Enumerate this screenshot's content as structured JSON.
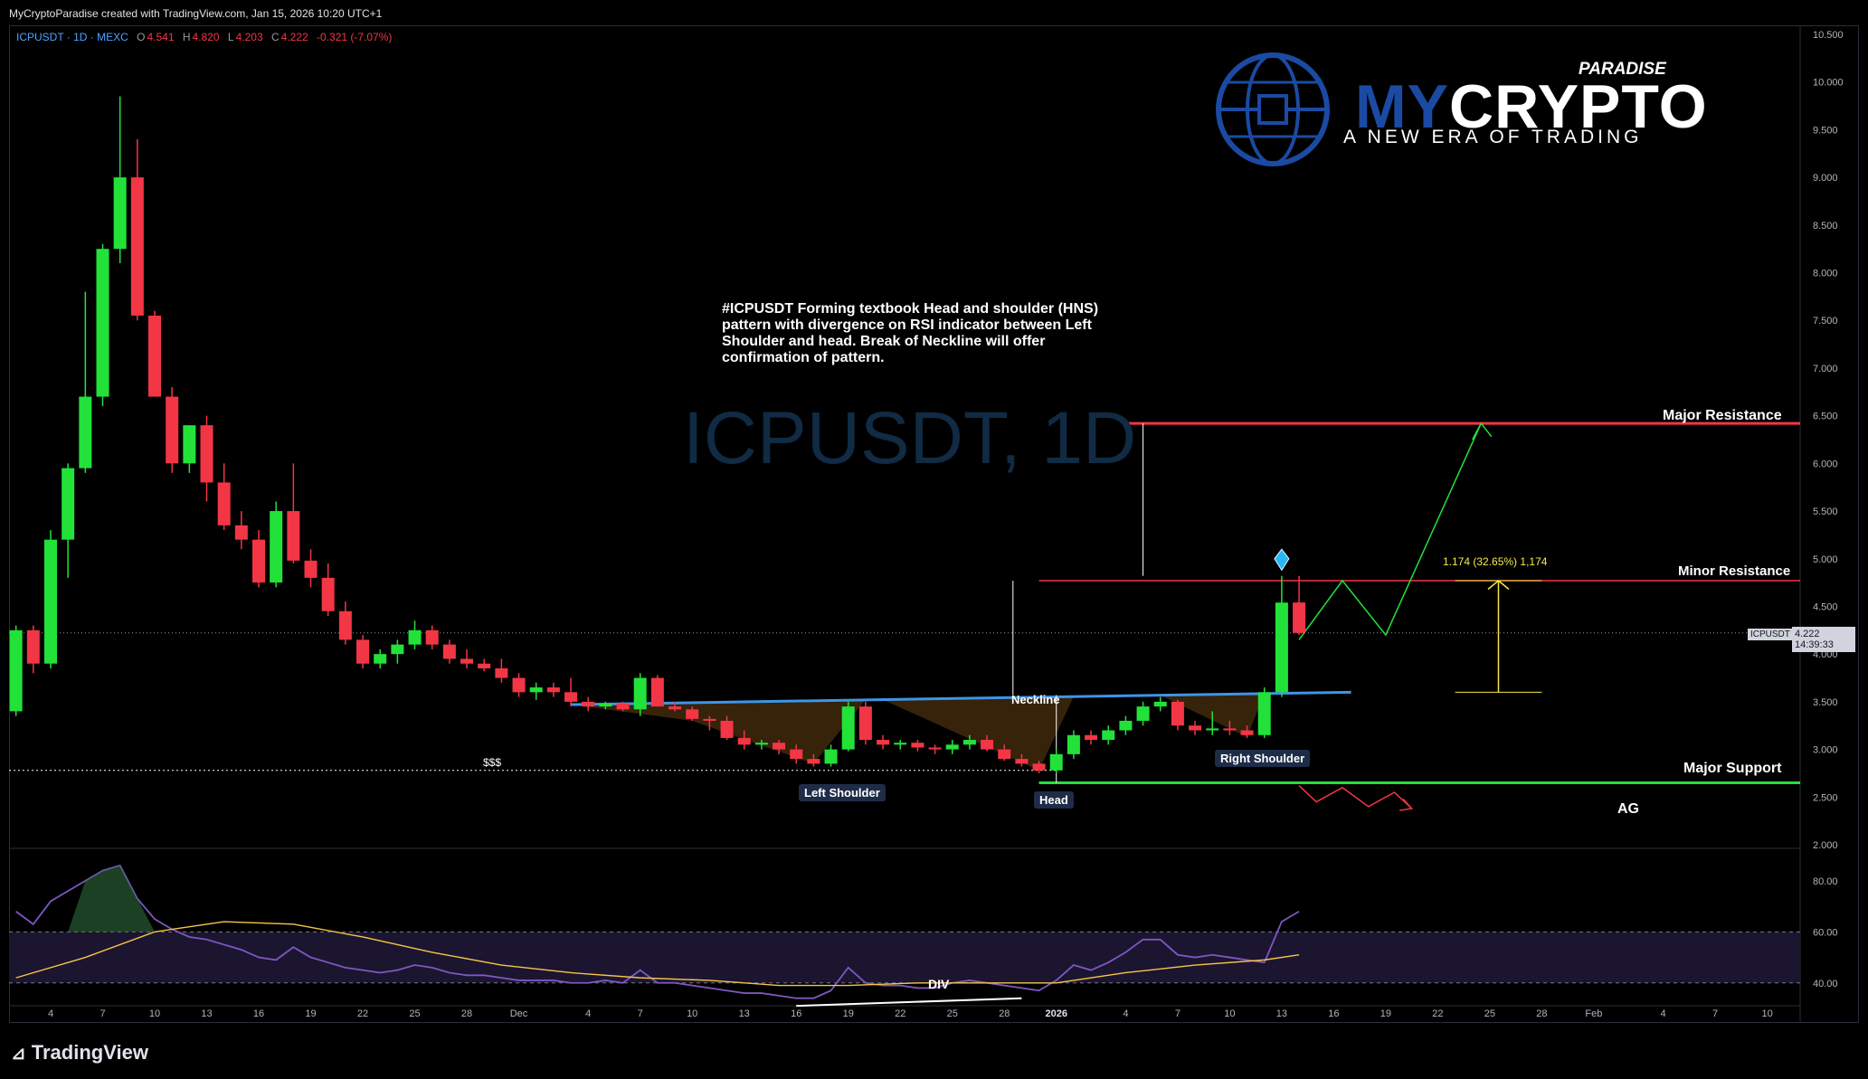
{
  "header": {
    "credit": "MyCryptoParadise created with TradingView.com, Jan 15, 2026 10:20 UTC+1",
    "symbol": "ICPUSDT · 1D · MEXC",
    "ohlc": {
      "o_label": "O",
      "o": "4.541",
      "h_label": "H",
      "h": "4.820",
      "l_label": "L",
      "l": "4.203",
      "c_label": "C",
      "c": "4.222",
      "change": "-0.321 (-7.07%)"
    }
  },
  "brand": {
    "name_part1": "MY",
    "name_part2": "CRYPTO",
    "paradise": "PARADISE",
    "tagline": "A NEW ERA OF TRADING",
    "colors": {
      "blue": "#1b4aa3",
      "white": "#ffffff"
    }
  },
  "analysis_text": "#ICPUSDT Forming textbook Head and shoulder (HNS) pattern with divergence on RSI indicator between Left Shoulder and head. Break of Neckline will offer confirmation of pattern.",
  "watermark": "ICPUSDT, 1D",
  "levels": {
    "major_resistance": {
      "label": "Major Resistance",
      "value": 6.42,
      "color": "#f23645"
    },
    "minor_resistance": {
      "label": "Minor Resistance",
      "value": 4.77,
      "color": "#f23645"
    },
    "major_support": {
      "label": "Major Support",
      "value": 2.65,
      "color": "#22e23a"
    },
    "dotted_level": {
      "label": "$$$",
      "value": 2.78
    }
  },
  "pattern_labels": {
    "neckline": "Neckline",
    "left_shoulder": "Left Shoulder",
    "head": "Head",
    "right_shoulder": "Right Shoulder",
    "div": "DIV",
    "ag": "AG"
  },
  "fib_text": "1.174 (32.65%) 1,174",
  "last_price": {
    "symbol": "ICPUSDT",
    "price": "4.222",
    "countdown": "14:39:33",
    "value": 4.222
  },
  "footer": {
    "logo": "TradingView"
  },
  "chart_data": [
    {
      "type": "candlestick",
      "title": "",
      "x_tick_labels": [
        "4",
        "7",
        "10",
        "13",
        "16",
        "19",
        "22",
        "25",
        "28",
        "Dec",
        "4",
        "7",
        "10",
        "13",
        "16",
        "19",
        "22",
        "25",
        "28",
        "2026",
        "4",
        "7",
        "10",
        "13",
        "16",
        "19",
        "22",
        "25",
        "28",
        "Feb",
        "4",
        "7",
        "10"
      ],
      "x_tick_days": [
        0,
        3,
        6,
        9,
        12,
        15,
        18,
        21,
        24,
        27,
        31,
        34,
        37,
        40,
        43,
        46,
        49,
        52,
        55,
        58,
        62,
        65,
        68,
        71,
        74,
        77,
        80,
        83,
        86,
        89,
        93,
        96,
        99
      ],
      "y_tick_labels": [
        "10.500",
        "10.000",
        "9.500",
        "9.000",
        "8.500",
        "8.000",
        "7.500",
        "7.000",
        "6.500",
        "6.000",
        "5.500",
        "5.000",
        "4.500",
        "4.000",
        "3.500",
        "3.000",
        "2.500",
        "2.000"
      ],
      "y_ticks": [
        10.5,
        10,
        9.5,
        9,
        8.5,
        8,
        7.5,
        7,
        6.5,
        6,
        5.5,
        5,
        4.5,
        4,
        3.5,
        3,
        2.5,
        2
      ],
      "ylim": [
        2.0,
        10.5
      ],
      "xlim": [
        -2.4,
        100.9
      ],
      "colors": {
        "up": "#22e23a",
        "down": "#f23645"
      },
      "candles": [
        [
          -2,
          3.4,
          4.3,
          3.35,
          4.25
        ],
        [
          -1,
          4.25,
          4.3,
          3.8,
          3.9
        ],
        [
          0,
          3.9,
          5.3,
          3.85,
          5.2
        ],
        [
          1,
          5.2,
          6.0,
          4.8,
          5.95
        ],
        [
          2,
          5.95,
          7.8,
          5.9,
          6.7
        ],
        [
          3,
          6.7,
          8.3,
          6.6,
          8.25
        ],
        [
          4,
          8.25,
          9.85,
          8.1,
          9.0
        ],
        [
          5,
          9.0,
          9.4,
          7.5,
          7.55
        ],
        [
          6,
          7.55,
          7.6,
          6.7,
          6.7
        ],
        [
          7,
          6.7,
          6.8,
          5.9,
          6.0
        ],
        [
          8,
          6.0,
          6.4,
          5.9,
          6.4
        ],
        [
          9,
          6.4,
          6.5,
          5.6,
          5.8
        ],
        [
          10,
          5.8,
          6.0,
          5.3,
          5.35
        ],
        [
          11,
          5.35,
          5.5,
          5.1,
          5.2
        ],
        [
          12,
          5.2,
          5.3,
          4.7,
          4.75
        ],
        [
          13,
          4.75,
          5.6,
          4.7,
          5.5
        ],
        [
          14,
          5.5,
          6.0,
          4.95,
          4.98
        ],
        [
          15,
          4.98,
          5.1,
          4.7,
          4.8
        ],
        [
          16,
          4.8,
          4.95,
          4.4,
          4.45
        ],
        [
          17,
          4.45,
          4.55,
          4.1,
          4.15
        ],
        [
          18,
          4.15,
          4.2,
          3.85,
          3.9
        ],
        [
          19,
          3.9,
          4.05,
          3.85,
          4.0
        ],
        [
          20,
          4.0,
          4.15,
          3.9,
          4.1
        ],
        [
          21,
          4.1,
          4.35,
          4.05,
          4.25
        ],
        [
          22,
          4.25,
          4.3,
          4.05,
          4.1
        ],
        [
          23,
          4.1,
          4.15,
          3.9,
          3.95
        ],
        [
          24,
          3.95,
          4.05,
          3.85,
          3.9
        ],
        [
          25,
          3.9,
          3.95,
          3.82,
          3.85
        ],
        [
          26,
          3.85,
          3.95,
          3.7,
          3.75
        ],
        [
          27,
          3.75,
          3.8,
          3.55,
          3.6
        ],
        [
          28,
          3.6,
          3.7,
          3.52,
          3.65
        ],
        [
          29,
          3.65,
          3.7,
          3.55,
          3.6
        ],
        [
          30,
          3.6,
          3.75,
          3.45,
          3.5
        ],
        [
          31,
          3.5,
          3.55,
          3.4,
          3.45
        ],
        [
          32,
          3.45,
          3.5,
          3.42,
          3.48
        ],
        [
          33,
          3.48,
          3.5,
          3.4,
          3.42
        ],
        [
          34,
          3.42,
          3.8,
          3.35,
          3.75
        ],
        [
          35,
          3.75,
          3.78,
          3.45,
          3.45
        ],
        [
          36,
          3.45,
          3.5,
          3.4,
          3.42
        ],
        [
          37,
          3.42,
          3.45,
          3.3,
          3.32
        ],
        [
          38,
          3.32,
          3.35,
          3.2,
          3.3
        ],
        [
          39,
          3.3,
          3.35,
          3.1,
          3.12
        ],
        [
          40,
          3.12,
          3.2,
          3.0,
          3.05
        ],
        [
          41,
          3.05,
          3.1,
          3.0,
          3.07
        ],
        [
          42,
          3.07,
          3.1,
          2.95,
          3.0
        ],
        [
          43,
          3.0,
          3.05,
          2.85,
          2.9
        ],
        [
          44,
          2.9,
          2.95,
          2.82,
          2.85
        ],
        [
          45,
          2.85,
          3.05,
          2.82,
          3.0
        ],
        [
          46,
          3.0,
          3.5,
          2.98,
          3.45
        ],
        [
          47,
          3.45,
          3.5,
          3.05,
          3.1
        ],
        [
          48,
          3.1,
          3.15,
          3.0,
          3.05
        ],
        [
          49,
          3.05,
          3.1,
          3.0,
          3.07
        ],
        [
          50,
          3.07,
          3.1,
          2.98,
          3.02
        ],
        [
          51,
          3.02,
          3.05,
          2.95,
          3.0
        ],
        [
          52,
          3.0,
          3.1,
          2.95,
          3.05
        ],
        [
          53,
          3.05,
          3.15,
          3.0,
          3.1
        ],
        [
          54,
          3.1,
          3.15,
          2.98,
          3.0
        ],
        [
          55,
          3.0,
          3.05,
          2.88,
          2.9
        ],
        [
          56,
          2.9,
          2.95,
          2.82,
          2.85
        ],
        [
          57,
          2.85,
          2.88,
          2.75,
          2.78
        ],
        [
          58,
          2.78,
          3.0,
          2.75,
          2.95
        ],
        [
          59,
          2.95,
          3.2,
          2.9,
          3.15
        ],
        [
          60,
          3.15,
          3.2,
          3.05,
          3.1
        ],
        [
          61,
          3.1,
          3.25,
          3.05,
          3.2
        ],
        [
          62,
          3.2,
          3.35,
          3.15,
          3.3
        ],
        [
          63,
          3.3,
          3.5,
          3.25,
          3.45
        ],
        [
          64,
          3.45,
          3.55,
          3.4,
          3.5
        ],
        [
          65,
          3.5,
          3.52,
          3.2,
          3.25
        ],
        [
          66,
          3.25,
          3.3,
          3.15,
          3.2
        ],
        [
          67,
          3.2,
          3.4,
          3.15,
          3.22
        ],
        [
          68,
          3.22,
          3.3,
          3.15,
          3.2
        ],
        [
          69,
          3.2,
          3.25,
          3.12,
          3.15
        ],
        [
          70,
          3.15,
          3.65,
          3.12,
          3.6
        ],
        [
          71,
          3.6,
          4.82,
          3.55,
          4.54
        ],
        [
          72,
          4.541,
          4.82,
          4.203,
          4.222
        ]
      ]
    },
    {
      "type": "line",
      "title": "",
      "ylim": [
        30,
        92
      ],
      "y_tick_labels": [
        "80.00",
        "60.00",
        "40.00"
      ],
      "y_ticks": [
        80,
        60,
        40
      ],
      "overbought": 60,
      "oversold": 40,
      "series": [
        {
          "color": "#7e57c2",
          "values": [
            [
              -2,
              68
            ],
            [
              -1,
              63
            ],
            [
              0,
              72
            ],
            [
              1,
              76
            ],
            [
              2,
              80
            ],
            [
              3,
              84
            ],
            [
              4,
              86
            ],
            [
              5,
              73
            ],
            [
              6,
              65
            ],
            [
              7,
              61
            ],
            [
              8,
              58
            ],
            [
              9,
              57
            ],
            [
              10,
              55
            ],
            [
              11,
              53
            ],
            [
              12,
              50
            ],
            [
              13,
              49
            ],
            [
              14,
              54
            ],
            [
              15,
              50
            ],
            [
              16,
              48
            ],
            [
              17,
              46
            ],
            [
              18,
              45
            ],
            [
              19,
              44
            ],
            [
              20,
              45
            ],
            [
              21,
              47
            ],
            [
              22,
              46
            ],
            [
              23,
              44
            ],
            [
              24,
              43
            ],
            [
              25,
              43
            ],
            [
              26,
              42
            ],
            [
              27,
              41
            ],
            [
              28,
              41
            ],
            [
              29,
              41
            ],
            [
              30,
              40
            ],
            [
              31,
              40
            ],
            [
              32,
              41
            ],
            [
              33,
              40
            ],
            [
              34,
              45
            ],
            [
              35,
              40
            ],
            [
              36,
              40
            ],
            [
              37,
              39
            ],
            [
              38,
              38
            ],
            [
              39,
              37
            ],
            [
              40,
              36
            ],
            [
              41,
              36
            ],
            [
              42,
              35
            ],
            [
              43,
              34
            ],
            [
              44,
              34
            ],
            [
              45,
              37
            ],
            [
              46,
              46
            ],
            [
              47,
              40
            ],
            [
              48,
              39
            ],
            [
              49,
              39
            ],
            [
              50,
              38
            ],
            [
              51,
              38
            ],
            [
              52,
              40
            ],
            [
              53,
              41
            ],
            [
              54,
              40
            ],
            [
              55,
              39
            ],
            [
              56,
              38
            ],
            [
              57,
              37
            ],
            [
              58,
              41
            ],
            [
              59,
              47
            ],
            [
              60,
              45
            ],
            [
              61,
              48
            ],
            [
              62,
              52
            ],
            [
              63,
              57
            ],
            [
              64,
              57
            ],
            [
              65,
              51
            ],
            [
              66,
              50
            ],
            [
              67,
              51
            ],
            [
              68,
              50
            ],
            [
              69,
              49
            ],
            [
              70,
              48
            ],
            [
              71,
              64
            ],
            [
              72,
              68
            ]
          ]
        },
        {
          "color": "#f7c548",
          "values": [
            [
              -2,
              42
            ],
            [
              2,
              50
            ],
            [
              6,
              60
            ],
            [
              10,
              64
            ],
            [
              14,
              63
            ],
            [
              18,
              58
            ],
            [
              22,
              52
            ],
            [
              26,
              47
            ],
            [
              30,
              44
            ],
            [
              34,
              42
            ],
            [
              38,
              41
            ],
            [
              42,
              39
            ],
            [
              46,
              39
            ],
            [
              50,
              40
            ],
            [
              54,
              40
            ],
            [
              58,
              40
            ],
            [
              62,
              44
            ],
            [
              66,
              47
            ],
            [
              70,
              49
            ],
            [
              72,
              51
            ]
          ]
        }
      ]
    }
  ]
}
